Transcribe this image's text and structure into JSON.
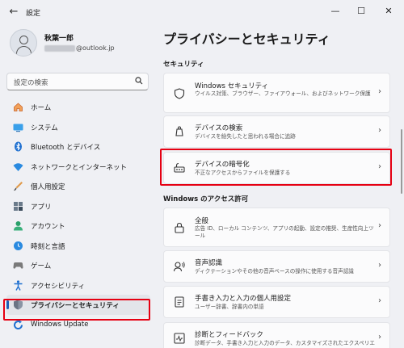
{
  "window": {
    "title": "設定",
    "back_glyph": "←",
    "minimize_glyph": "—",
    "maximize_glyph": "☐",
    "close_glyph": "✕"
  },
  "user": {
    "name": "秋葉一郎",
    "email_suffix": "@outlook.jp"
  },
  "search": {
    "placeholder": "設定の検索"
  },
  "nav": [
    {
      "label": "ホーム",
      "icon": "home-icon",
      "color": "#e07a3a"
    },
    {
      "label": "システム",
      "icon": "system-icon",
      "color": "#1e88d8"
    },
    {
      "label": "Bluetooth とデバイス",
      "icon": "bluetooth-icon",
      "color": "#1e6fd0"
    },
    {
      "label": "ネットワークとインターネット",
      "icon": "network-icon",
      "color": "#1e88d8"
    },
    {
      "label": "個人用設定",
      "icon": "personalization-icon",
      "color": "#d88a3a"
    },
    {
      "label": "アプリ",
      "icon": "apps-icon",
      "color": "#5a6a7a"
    },
    {
      "label": "アカウント",
      "icon": "accounts-icon",
      "color": "#2aa06a"
    },
    {
      "label": "時刻と言語",
      "icon": "time-language-icon",
      "color": "#1e88d8"
    },
    {
      "label": "ゲーム",
      "icon": "gaming-icon",
      "color": "#7a7a7a"
    },
    {
      "label": "アクセシビリティ",
      "icon": "accessibility-icon",
      "color": "#1e6fd0"
    },
    {
      "label": "プライバシーとセキュリティ",
      "icon": "privacy-shield-icon",
      "color": "#7a8494",
      "selected": true
    },
    {
      "label": "Windows Update",
      "icon": "windows-update-icon",
      "color": "#1e6fd0"
    }
  ],
  "main": {
    "title": "プライバシーとセキュリティ",
    "security_heading": "セキュリティ",
    "security_cards": [
      {
        "title": "Windows セキュリティ",
        "desc": "ウイルス対策、ブラウザー、ファイアウォール、およびネットワーク保護",
        "icon": "shield-icon"
      },
      {
        "title": "デバイスの検索",
        "desc": "デバイスを紛失したと思われる場合に追跡",
        "icon": "find-device-icon"
      },
      {
        "title": "デバイスの暗号化",
        "desc": "不正なアクセスからファイルを保護する",
        "icon": "encryption-icon"
      }
    ],
    "permissions_heading": "Windows のアクセス許可",
    "permission_cards": [
      {
        "title": "全般",
        "desc": "広告 ID、ローカル コンテンツ、アプリの起動、設定の推奨、生産性向上ツール",
        "icon": "lock-icon"
      },
      {
        "title": "音声認識",
        "desc": "ディクテーションやその他の音声ベースの操作に使用する音声認識",
        "icon": "speech-icon"
      },
      {
        "title": "手書き入力と入力の個人用設定",
        "desc": "ユーザー辞書、辞書内の単語",
        "icon": "inking-typing-icon"
      },
      {
        "title": "診断とフィードバック",
        "desc": "診断データ、手書き入力と入力のデータ、カスタマイズされたエクスペリエンス",
        "icon": "diagnostics-icon"
      }
    ],
    "chevron_glyph": "›"
  },
  "colors": {
    "highlight_red": "#e60012",
    "accent_blue": "#1c5fb6"
  }
}
